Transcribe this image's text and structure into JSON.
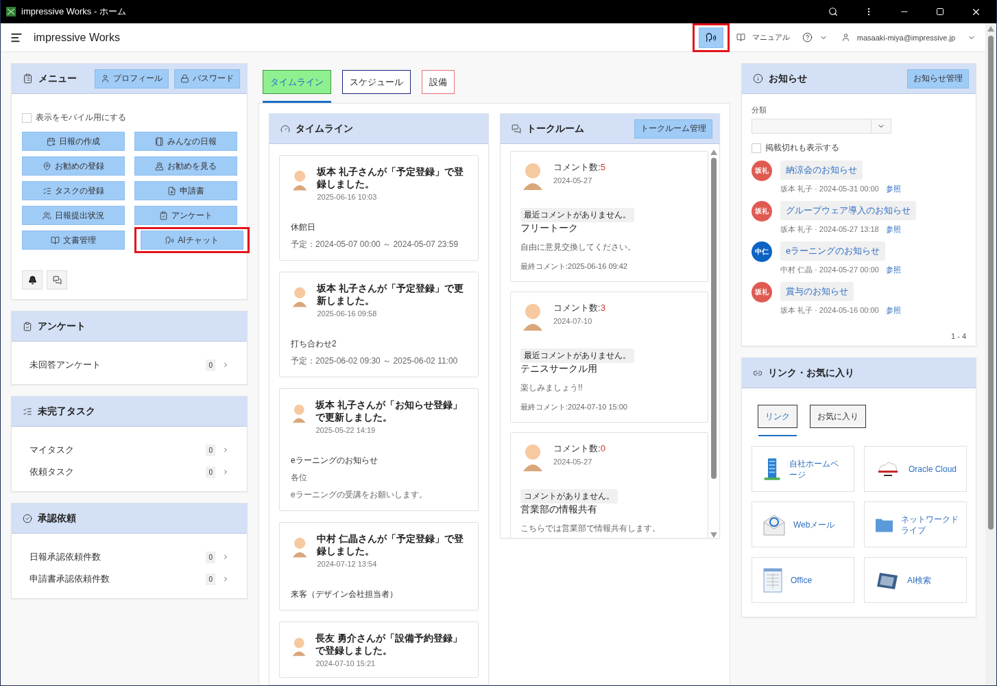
{
  "window": {
    "title": "impressive Works - ホーム"
  },
  "header": {
    "app_name": "impressive Works",
    "ai_button": {
      "highlighted": true
    },
    "manual": "マニュアル",
    "user": "masaaki-miya@impressive.jp"
  },
  "menu": {
    "title": "メニュー",
    "header_buttons": [
      {
        "label": "プロフィール"
      },
      {
        "label": "パスワード"
      }
    ],
    "mobile_toggle": {
      "label": "表示をモバイル用にする",
      "checked": false
    },
    "buttons": [
      {
        "label": "日報の作成",
        "highlighted": false
      },
      {
        "label": "みんなの日報",
        "highlighted": false
      },
      {
        "label": "お勧めの登録",
        "highlighted": false
      },
      {
        "label": "お勧めを見る",
        "highlighted": false
      },
      {
        "label": "タスクの登録",
        "highlighted": false
      },
      {
        "label": "申請書",
        "highlighted": false
      },
      {
        "label": "日報提出状況",
        "highlighted": false
      },
      {
        "label": "アンケート",
        "highlighted": false
      },
      {
        "label": "文書管理",
        "highlighted": false
      },
      {
        "label": "AIチャット",
        "highlighted": true
      }
    ]
  },
  "side_panels": [
    {
      "title": "アンケート",
      "items": [
        {
          "label": "未回答アンケート",
          "count": "0"
        }
      ]
    },
    {
      "title": "未完了タスク",
      "items": [
        {
          "label": "マイタスク",
          "count": "0"
        },
        {
          "label": "依頼タスク",
          "count": "0"
        }
      ]
    },
    {
      "title": "承認依頼",
      "items": [
        {
          "label": "日報承認依頼件数",
          "count": "0"
        },
        {
          "label": "申請書承認依頼件数",
          "count": "0"
        }
      ]
    }
  ],
  "tabs": [
    {
      "label": "タイムライン",
      "selected": true,
      "color": "#3a9a3a"
    },
    {
      "label": "スケジュール",
      "selected": false,
      "color": "#1a237e"
    },
    {
      "label": "設備",
      "selected": false,
      "color": "#e57373"
    }
  ],
  "timeline": {
    "title": "タイムライン",
    "items": [
      {
        "headline": "坂本 礼子さんが「予定登録」で登録しました。",
        "date": "2025-06-16 10:03",
        "subject": "休館日",
        "lines": [
          "予定：2024-05-07 00:00 ～ 2024-05-07 23:59"
        ]
      },
      {
        "headline": "坂本 礼子さんが「予定登録」で更新しました。",
        "date": "2025-06-16 09:58",
        "subject": "打ち合わせ2",
        "lines": [
          "予定：2025-06-02 09:30 ～ 2025-06-02 11:00"
        ]
      },
      {
        "headline": "坂本 礼子さんが「お知らせ登録」で更新しました。",
        "date": "2025-05-22 14:19",
        "subject": "eラーニングのお知らせ",
        "lines": [
          "各位",
          "eラーニングの受講をお願いします。"
        ]
      },
      {
        "headline": "中村 仁晶さんが「予定登録」で登録しました。",
        "date": "2024-07-12 13:54",
        "subject": "来客（デザイン会社担当者）"
      },
      {
        "headline": "長友 勇介さんが「設備予約登録」で登録しました。",
        "date": "2024-07-10 15:21"
      }
    ]
  },
  "talkroom": {
    "title": "トークルーム",
    "manage_button": "トークルーム管理",
    "rooms": [
      {
        "count_label": "コメント数:",
        "count": "5",
        "date": "2024-05-27",
        "status": "最近コメントがありません。",
        "title": "フリートーク",
        "description": "自由に意見交換してください。",
        "last_comment": "最終コメント:2025-06-16 09:42"
      },
      {
        "count_label": "コメント数:",
        "count": "3",
        "date": "2024-07-10",
        "status": "最近コメントがありません。",
        "title": "テニスサークル用",
        "description": "楽しみましょう!!",
        "last_comment": "最終コメント:2024-07-10 15:00"
      },
      {
        "count_label": "コメント数:",
        "count": "0",
        "date": "2024-05-27",
        "status": "コメントがありません。",
        "title": "営業部の情報共有",
        "description": "こちらでは営業部で情報共有します。"
      }
    ]
  },
  "notices": {
    "title": "お知らせ",
    "manage_button": "お知らせ管理",
    "category_label": "分類",
    "show_expired": {
      "label": "掲載切れも表示する",
      "checked": false
    },
    "items": [
      {
        "initials": "坂礼",
        "color": "#e05a52",
        "title": "納涼会のお知らせ",
        "meta": "坂本 礼子 · 2024-05-31 00:00",
        "link": "参照"
      },
      {
        "initials": "坂礼",
        "color": "#e05a52",
        "title": "グループウェア導入のお知らせ",
        "meta": "坂本 礼子 · 2024-05-27 13:18",
        "link": "参照"
      },
      {
        "initials": "中仁",
        "color": "#0b63c4",
        "title": "eラーニングのお知らせ",
        "meta": "中村 仁晶 · 2024-05-27 00:00",
        "link": "参照"
      },
      {
        "initials": "坂礼",
        "color": "#e05a52",
        "title": "賞与のお知らせ",
        "meta": "坂本 礼子 · 2024-05-16 00:00",
        "link": "参照"
      }
    ],
    "pagination": "1 - 4"
  },
  "links": {
    "title": "リンク・お気に入り",
    "tabs": [
      {
        "label": "リンク",
        "selected": true
      },
      {
        "label": "お気に入り",
        "selected": false
      }
    ],
    "items": [
      {
        "label": "自社ホームページ"
      },
      {
        "label": "Oracle Cloud"
      },
      {
        "label": "Webメール"
      },
      {
        "label": "ネットワークドライブ"
      },
      {
        "label": "Office"
      },
      {
        "label": "AI検索"
      }
    ]
  }
}
